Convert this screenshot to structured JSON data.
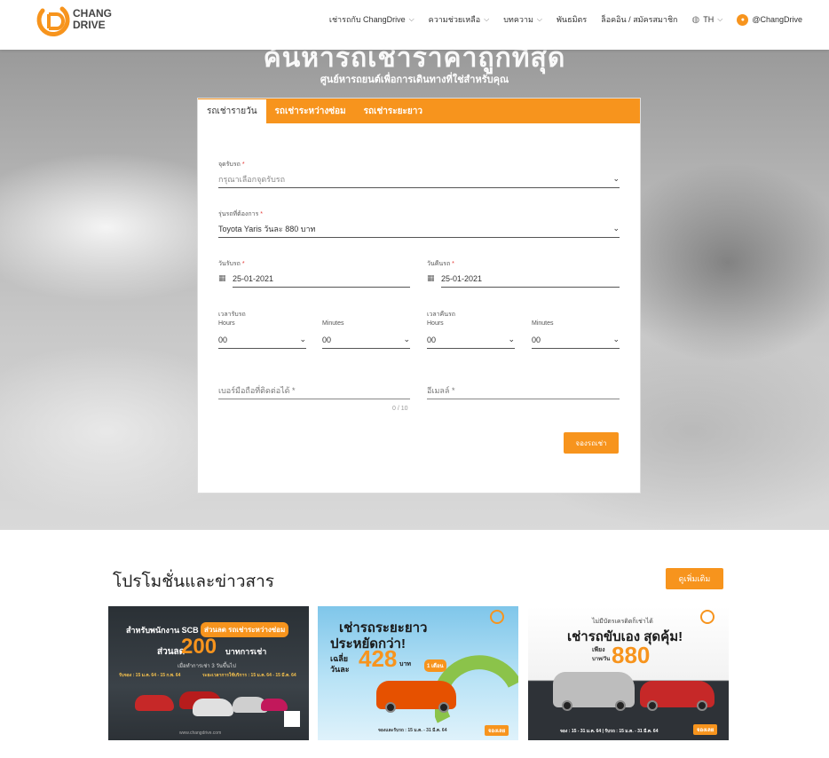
{
  "header": {
    "logo_line1": "CHANG",
    "logo_line2": "DRIVE",
    "nav": [
      {
        "label": "เช่ารถกับ ChangDrive",
        "has_dropdown": true
      },
      {
        "label": "ความช่วยเหลือ",
        "has_dropdown": true
      },
      {
        "label": "บทความ",
        "has_dropdown": true
      },
      {
        "label": "พันธมิตร",
        "has_dropdown": false
      },
      {
        "label": "ล็อคอิน / สมัครสมาชิก",
        "has_dropdown": false
      }
    ],
    "language": "TH",
    "line_id": "@ChangDrive",
    "accent_color": "#f7941d"
  },
  "hero": {
    "title": "ค้นหารถเช่าราคาถูกที่สุด",
    "subtitle": "ศูนย์หารถยนต์เพื่อการเดินทางที่ใช่สำหรับคุณ"
  },
  "booking": {
    "tabs": [
      "รถเช่ารายวัน",
      "รถเช่าระหว่างซ่อม",
      "รถเช่าระยะยาว"
    ],
    "pickup_label": "จุดรับรถ",
    "pickup_placeholder": "กรุณาเลือกจุดรับรถ",
    "model_label": "รุ่นรถที่ต้องการ",
    "model_value": "Toyota Yaris วันละ 880 บาท",
    "pickup_date_label": "วันรับรถ",
    "pickup_date": "25-01-2021",
    "return_date_label": "วันคืนรถ",
    "return_date": "25-01-2021",
    "pickup_time_label": "เวลารับรถ",
    "return_time_label": "เวลาคืนรถ",
    "hours_label": "Hours",
    "minutes_label": "Minutes",
    "pickup_hour": "00",
    "pickup_minute": "00",
    "return_hour": "00",
    "return_minute": "00",
    "phone_label": "เบอร์มือถือที่ติดต่อได้ *",
    "phone_counter": "0 / 10",
    "email_label": "อีเมลล์ *",
    "submit_label": "จองรถเช่า",
    "required_mark": "*"
  },
  "promos": {
    "title": "โปรโมชั่นและข่าวสาร",
    "more_label": "ดูเพิ่มเติม",
    "cards": [
      {
        "headline": "สำหรับพนักงาน SCB",
        "tag": "ส่วนลด รถเช่าระหว่างซ่อม",
        "discount_prefix": "ส่วนลด",
        "discount_value": "200",
        "discount_unit": "บาทการเช่า",
        "condition": "เมื่อทำการเช่า 3 วันขึ้นไป",
        "period": "รับจอง : 15 ม.ค. 64 - 15 ก.พ. 64",
        "usage": "ระยะเวลาการใช้บริการ : 15 ม.ค. 64 - 15 มี.ค. 64",
        "footer": "www.changdrive.com"
      },
      {
        "headline1": "เช่ารถระยะยาว",
        "headline2": "ประหยัดกว่า!",
        "avg_label": "เฉลี่ย",
        "per_day": "วันละ",
        "price": "428",
        "unit": "บาท",
        "badge": "1 เดือน",
        "period": "จองและรับรถ : 15 ม.ค. - 31 มี.ค. 64",
        "cta": "จองเลย"
      },
      {
        "top": "ไม่มีบัตรเครดิตก็เช่าได้",
        "headline": "เช่ารถขับเอง สุดคุ้ม!",
        "lead": "เพียง",
        "unit": "บาท/วัน",
        "price": "880",
        "period": "จอง : 15 - 31 ม.ค. 64 | รับรถ : 15 ม.ค. - 31 มี.ค. 64",
        "cta": "จองเลย"
      }
    ]
  }
}
